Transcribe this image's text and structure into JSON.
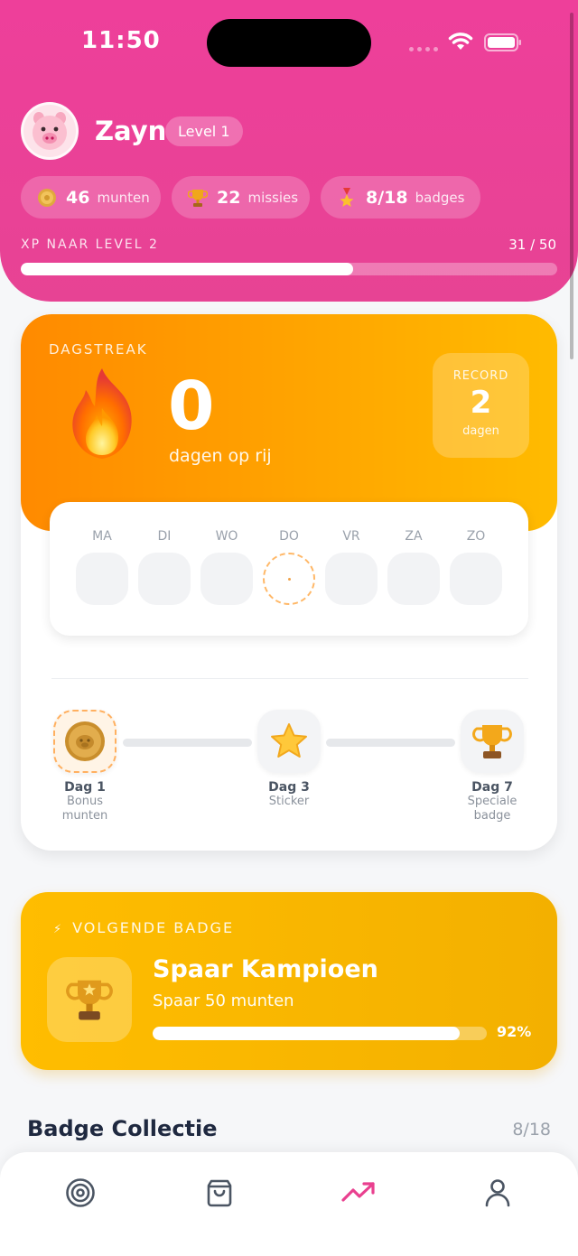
{
  "status": {
    "time": "11:50"
  },
  "profile": {
    "name": "Zayn",
    "level": "Level 1"
  },
  "stats": [
    {
      "icon": "coin-icon",
      "value": "46",
      "label": "munten"
    },
    {
      "icon": "trophy-icon",
      "value": "22",
      "label": "missies"
    },
    {
      "icon": "medal-icon",
      "value": "8/18",
      "label": "badges"
    }
  ],
  "xp": {
    "label": "XP NAAR LEVEL 2",
    "value": "31 / 50",
    "progress": 0.62
  },
  "streak": {
    "title": "DAGSTREAK",
    "count": "0",
    "subtitle": "dagen op rij",
    "record_label": "RECORD",
    "record_value": "2",
    "record_unit": "dagen",
    "days": [
      "MA",
      "DI",
      "WO",
      "DO",
      "VR",
      "ZA",
      "ZO"
    ],
    "today_index": 3,
    "milestones": [
      {
        "day": "Dag 1",
        "desc": "Bonus munten",
        "icon": "coin-icon"
      },
      {
        "day": "Dag 3",
        "desc": "Sticker",
        "icon": "star-icon"
      },
      {
        "day": "Dag 7",
        "desc": "Speciale badge",
        "icon": "trophy-icon"
      }
    ]
  },
  "next_badge": {
    "heading": "VOLGENDE BADGE",
    "name": "Spaar Kampioen",
    "description": "Spaar 50 munten",
    "percent_label": "92%",
    "progress": 0.92
  },
  "collection": {
    "title": "Badge Collectie",
    "count": "8/18"
  },
  "tabs": [
    {
      "icon": "target-icon",
      "active": false
    },
    {
      "icon": "shopping-bag-icon",
      "active": false
    },
    {
      "icon": "trending-up-icon",
      "active": true
    },
    {
      "icon": "user-icon",
      "active": false
    }
  ],
  "colors": {
    "primary": "#EC4899",
    "streak": "#FF9800",
    "badge": "#FFBD00"
  }
}
